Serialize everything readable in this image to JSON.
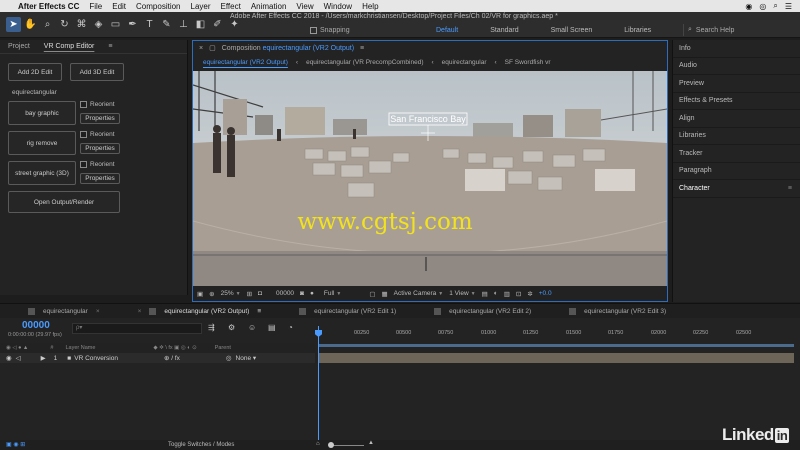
{
  "menubar": {
    "app_name": "After Effects CC",
    "items": [
      "File",
      "Edit",
      "Composition",
      "Layer",
      "Effect",
      "Animation",
      "View",
      "Window",
      "Help"
    ]
  },
  "toolbar": {
    "doc_title": "Adobe After Effects CC 2018 - /Users/markchristiansen/Desktop/Project Files/Ch 02/VR for graphics.aep *",
    "snapping": "Snapping",
    "workspaces": [
      "Default",
      "Standard",
      "Small Screen",
      "Libraries"
    ],
    "active_workspace": "Default",
    "search_placeholder": "Search Help"
  },
  "left_panel": {
    "tabs": [
      "Project",
      "VR Comp Editor"
    ],
    "add_2d": "Add 2D Edit",
    "add_3d": "Add 3D Edit",
    "section": "equirectangular",
    "edits": [
      {
        "name": "bay graphic",
        "reorient": "Reorient",
        "properties": "Properties"
      },
      {
        "name": "rig remove",
        "reorient": "Reorient",
        "properties": "Properties"
      },
      {
        "name": "street graphic (3D)",
        "reorient": "Reorient",
        "properties": "Properties"
      }
    ],
    "open_output": "Open Output/Render"
  },
  "comp": {
    "header_label": "Composition",
    "header_name": "equirectangular (VR2 Output)",
    "breadcrumbs": [
      "equirectangular (VR2 Output)",
      "equirectangular (VR PrecompCombined)",
      "equirectangular",
      "SF Swordfish vr"
    ],
    "scene_label": "San Francisco Bay",
    "footer": {
      "zoom": "25%",
      "timecode": "00000",
      "resolution": "Full",
      "camera": "Active Camera",
      "views": "1 View",
      "exposure": "+0.0"
    }
  },
  "watermark": "www.cgtsj.com",
  "right_panel": {
    "items": [
      "Info",
      "Audio",
      "Preview",
      "Effects & Presets",
      "Align",
      "Libraries",
      "Tracker",
      "Paragraph",
      "Character"
    ]
  },
  "timeline": {
    "tabs": [
      "equirectangular",
      "equirectangular (VR2 Output)",
      "equirectangular (VR2 Edit 1)",
      "equirectangular (VR2 Edit 2)",
      "equirectangular (VR2 Edit 3)"
    ],
    "timecode": "00000",
    "timecode_sub": "0:00:00:00 (29.97 fps)",
    "search_placeholder": "ρ▾",
    "ruler_ticks": [
      "00250",
      "00500",
      "00750",
      "01000",
      "01250",
      "01500",
      "01750",
      "02000",
      "02250",
      "02500"
    ],
    "columns": {
      "num": "#",
      "layer_name": "Layer Name",
      "parent": "Parent"
    },
    "layer": {
      "index": "1",
      "name": "VR Conversion",
      "parent": "None"
    },
    "toggle_label": "Toggle Switches / Modes"
  },
  "brand": {
    "linked": "Linked",
    "in": "in"
  },
  "colors": {
    "accent": "#4a9bff",
    "comp_border": "#2f6dbb",
    "watermark": "#f2e21d"
  }
}
